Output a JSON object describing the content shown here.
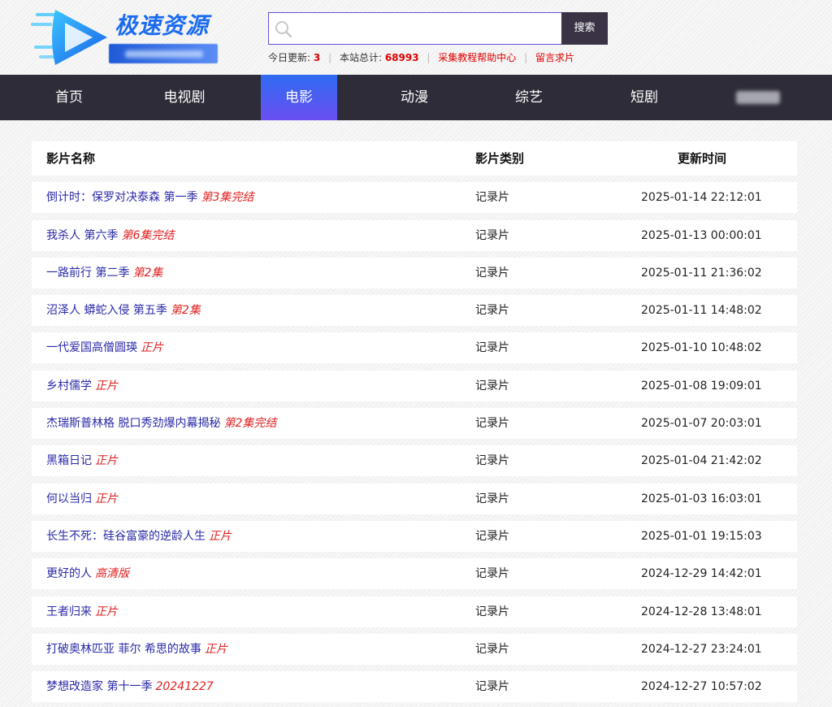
{
  "header": {
    "logo_text": "极速资源",
    "search": {
      "placeholder": "",
      "button_label": "搜索"
    },
    "stats": {
      "today_label": "今日更新:",
      "today_count": "3",
      "total_label": "本站总计:",
      "total_count": "68993",
      "help_link": "采集教程帮助中心",
      "message_link": "留言求片"
    }
  },
  "nav": {
    "items": [
      {
        "label": "首页"
      },
      {
        "label": "电视剧"
      },
      {
        "label": "电影"
      },
      {
        "label": "动漫"
      },
      {
        "label": "综艺"
      },
      {
        "label": "短剧"
      }
    ],
    "active": "电影"
  },
  "table": {
    "headers": {
      "title": "影片名称",
      "category": "影片类别",
      "time": "更新时间"
    },
    "rows": [
      {
        "title": "倒计时：保罗对决泰森 第一季",
        "status": "第3集完结",
        "category": "记录片",
        "time": "2025-01-14 22:12:01"
      },
      {
        "title": "我杀人 第六季",
        "status": "第6集完结",
        "category": "记录片",
        "time": "2025-01-13 00:00:01"
      },
      {
        "title": "一路前行 第二季",
        "status": "第2集",
        "category": "记录片",
        "time": "2025-01-11 21:36:02"
      },
      {
        "title": "沼泽人 蟒蛇入侵 第五季",
        "status": "第2集",
        "category": "记录片",
        "time": "2025-01-11 14:48:02"
      },
      {
        "title": "一代爱国高僧圆瑛",
        "status": "正片",
        "category": "记录片",
        "time": "2025-01-10 10:48:02"
      },
      {
        "title": "乡村儒学",
        "status": "正片",
        "category": "记录片",
        "time": "2025-01-08 19:09:01"
      },
      {
        "title": "杰瑞斯普林格 脱口秀劲爆内幕揭秘",
        "status": "第2集完结",
        "category": "记录片",
        "time": "2025-01-07 20:03:01"
      },
      {
        "title": "黑箱日记",
        "status": "正片",
        "category": "记录片",
        "time": "2025-01-04 21:42:02"
      },
      {
        "title": "何以当归",
        "status": "正片",
        "category": "记录片",
        "time": "2025-01-03 16:03:01"
      },
      {
        "title": "长生不死：硅谷富豪的逆龄人生",
        "status": "正片",
        "category": "记录片",
        "time": "2025-01-01 19:15:03"
      },
      {
        "title": "更好的人",
        "status": "高清版",
        "category": "记录片",
        "time": "2024-12-29 14:42:01"
      },
      {
        "title": "王者归来",
        "status": "正片",
        "category": "记录片",
        "time": "2024-12-28 13:48:01"
      },
      {
        "title": "打破奥林匹亚 菲尔 希思的故事",
        "status": "正片",
        "category": "记录片",
        "time": "2024-12-27 23:24:01"
      },
      {
        "title": "梦想改造家 第十一季",
        "status": "20241227",
        "category": "记录片",
        "time": "2024-12-27 10:57:02"
      }
    ]
  },
  "colors": {
    "nav_bg": "#2d2c38",
    "nav_active": "#4a5df2",
    "title_link": "#2a2aa8",
    "status_red": "#e02020",
    "stat_red": "#e00000",
    "search_border": "#6b4fd8"
  },
  "icons": {
    "search": "search-icon",
    "logo": "play-logo-icon"
  }
}
